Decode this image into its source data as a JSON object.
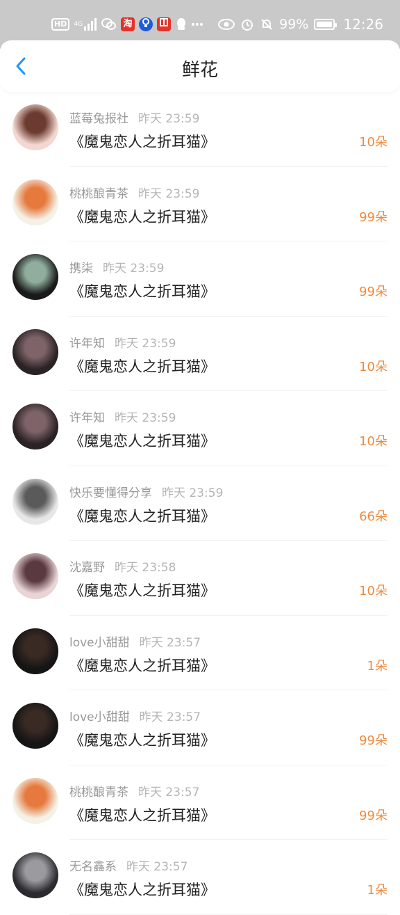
{
  "status_bar": {
    "hd": "HD",
    "network": "4G",
    "taobao": "淘",
    "battery_percent": "99%",
    "time": "12:26",
    "battery_level": 0.99
  },
  "header": {
    "title": "鲜花"
  },
  "items": [
    {
      "name": "蓝莓兔报社",
      "time": "昨天 23:59",
      "book": "《魔鬼恋人之折耳猫》",
      "amount": "10朵",
      "avatar_colors": [
        "#f3d7d0",
        "#6b3b2f"
      ]
    },
    {
      "name": "桃桃酿青茶",
      "time": "昨天 23:59",
      "book": "《魔鬼恋人之折耳猫》",
      "amount": "99朵",
      "avatar_colors": [
        "#f4f1e6",
        "#e6793d"
      ]
    },
    {
      "name": "携柒",
      "time": "昨天 23:59",
      "book": "《魔鬼恋人之折耳猫》",
      "amount": "99朵",
      "avatar_colors": [
        "#1a1a1a",
        "#8fae9d"
      ]
    },
    {
      "name": "许年知",
      "time": "昨天 23:59",
      "book": "《魔鬼恋人之折耳猫》",
      "amount": "10朵",
      "avatar_colors": [
        "#2a2224",
        "#7e6468"
      ]
    },
    {
      "name": "许年知",
      "time": "昨天 23:59",
      "book": "《魔鬼恋人之折耳猫》",
      "amount": "10朵",
      "avatar_colors": [
        "#2a2224",
        "#7e6468"
      ]
    },
    {
      "name": "快乐要懂得分享",
      "time": "昨天 23:59",
      "book": "《魔鬼恋人之折耳猫》",
      "amount": "66朵",
      "avatar_colors": [
        "#e7e7e7",
        "#5a5a5a"
      ]
    },
    {
      "name": "沈嘉野",
      "time": "昨天 23:58",
      "book": "《魔鬼恋人之折耳猫》",
      "amount": "10朵",
      "avatar_colors": [
        "#e9d4d6",
        "#5a3a40"
      ]
    },
    {
      "name": "love小甜甜",
      "time": "昨天 23:57",
      "book": "《魔鬼恋人之折耳猫》",
      "amount": "1朵",
      "avatar_colors": [
        "#151515",
        "#3a2a24"
      ]
    },
    {
      "name": "love小甜甜",
      "time": "昨天 23:57",
      "book": "《魔鬼恋人之折耳猫》",
      "amount": "99朵",
      "avatar_colors": [
        "#151515",
        "#3a2a24"
      ]
    },
    {
      "name": "桃桃酿青茶",
      "time": "昨天 23:57",
      "book": "《魔鬼恋人之折耳猫》",
      "amount": "99朵",
      "avatar_colors": [
        "#f4f1e6",
        "#e6793d"
      ]
    },
    {
      "name": "无名鑫系",
      "time": "昨天 23:57",
      "book": "《魔鬼恋人之折耳猫》",
      "amount": "1朵",
      "avatar_colors": [
        "#2b2b2f",
        "#9b9b9f"
      ]
    }
  ],
  "colors": {
    "accent": "#2196f3",
    "amount": "#ef8a3c"
  }
}
